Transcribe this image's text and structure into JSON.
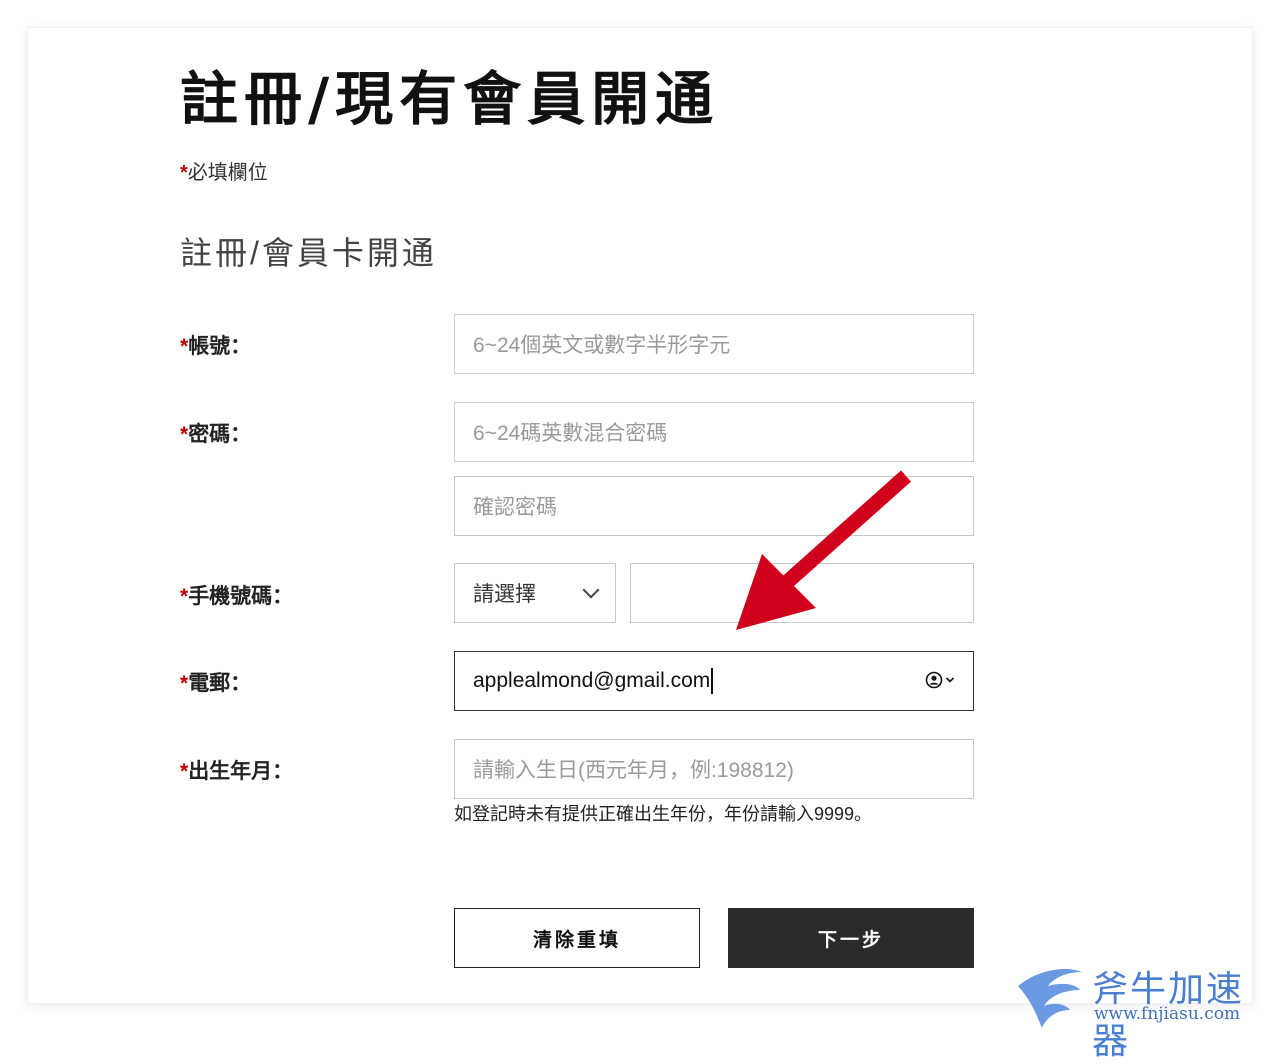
{
  "page_title": "註冊/現有會員開通",
  "required_note": {
    "mark": "*",
    "text": "必填欄位"
  },
  "section_title": "註冊/會員卡開通",
  "fields": {
    "account": {
      "mark": "*",
      "label": "帳號：",
      "placeholder": "6~24個英文或數字半形字元"
    },
    "password": {
      "mark": "*",
      "label": "密碼：",
      "placeholder": "6~24碼英數混合密碼",
      "confirm_placeholder": "確認密碼"
    },
    "phone": {
      "mark": "*",
      "label": "手機號碼：",
      "country_select": "請選擇",
      "number_value": ""
    },
    "email": {
      "mark": "*",
      "label": "電郵：",
      "value": "applealmond@gmail.com"
    },
    "birthday": {
      "mark": "*",
      "label": "出生年月：",
      "placeholder": "請輸入生日(西元年月，例:198812)",
      "hint": "如登記時未有提供正確出生年份，年份請輸入9999。"
    }
  },
  "buttons": {
    "reset": "清除重填",
    "next": "下一步"
  },
  "watermark": {
    "brand": "斧牛加速器",
    "url": "www.fnjiasu.com"
  },
  "colors": {
    "required_mark": "#c20000",
    "primary_button": "#2b2b2b",
    "annotation_arrow": "#d0021b"
  }
}
